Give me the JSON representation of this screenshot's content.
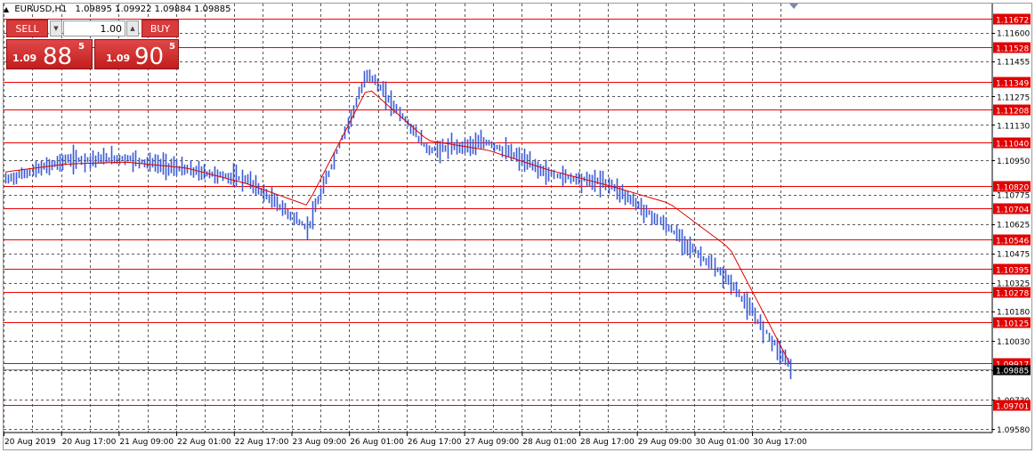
{
  "header": {
    "symbol": "EURUSD,H1",
    "ohlc": "1.09895 1.09922 1.09884 1.09885"
  },
  "trade_panel": {
    "sell_label": "SELL",
    "buy_label": "BUY",
    "volume": "1.00",
    "sell_price": {
      "small": "1.09",
      "big": "88",
      "sup": "5"
    },
    "buy_price": {
      "small": "1.09",
      "big": "90",
      "sup": "5"
    }
  },
  "colors": {
    "candle": "#3b5bd6",
    "moving_average": "#e00000",
    "level_line": "#ee0000",
    "label_bg": "#e00000",
    "grid": "#5a5a5a",
    "background": "#ffffff"
  },
  "price_axis": {
    "ticks": [
      "1.11600",
      "1.11455",
      "1.11275",
      "1.11130",
      "1.10950",
      "1.10775",
      "1.10625",
      "1.10475",
      "1.10325",
      "1.10180",
      "1.10030",
      "1.09880",
      "1.09730",
      "1.09580"
    ]
  },
  "levels": [
    {
      "label": "1.11672",
      "value": 1.11672
    },
    {
      "label": "1.11528",
      "value": 1.11528
    },
    {
      "label": "1.11349",
      "value": 1.11349
    },
    {
      "label": "1.11208",
      "value": 1.11208
    },
    {
      "label": "1.11040",
      "value": 1.1104
    },
    {
      "label": "1.10820",
      "value": 1.1082
    },
    {
      "label": "1.10704",
      "value": 1.10704
    },
    {
      "label": "1.10546",
      "value": 1.10546
    },
    {
      "label": "1.10395",
      "value": 1.10395
    },
    {
      "label": "1.10278",
      "value": 1.10278
    },
    {
      "label": "1.10125",
      "value": 1.10125
    },
    {
      "label": "1.09917",
      "value": 1.09917
    },
    {
      "label": "1.09701",
      "value": 1.09701
    }
  ],
  "current_price": {
    "label": "1.09885",
    "value": 1.09885
  },
  "time_axis": {
    "labels": [
      "20 Aug 2019",
      "20 Aug 17:00",
      "21 Aug 09:00",
      "22 Aug 01:00",
      "22 Aug 17:00",
      "23 Aug 09:00",
      "26 Aug 01:00",
      "26 Aug 17:00",
      "27 Aug 09:00",
      "28 Aug 01:00",
      "28 Aug 17:00",
      "29 Aug 09:00",
      "30 Aug 01:00",
      "30 Aug 17:00"
    ]
  },
  "chart_data": {
    "type": "line",
    "title": "EURUSD,H1",
    "xlabel": "",
    "ylabel": "",
    "ylim": [
      1.0958,
      1.1172
    ],
    "grid": true,
    "series": [
      {
        "name": "EURUSD,H1",
        "x": [
          "20 Aug 2019",
          "20 Aug 17:00",
          "21 Aug 09:00",
          "22 Aug 01:00",
          "22 Aug 17:00",
          "23 Aug 09:00",
          "26 Aug 01:00",
          "26 Aug 17:00",
          "27 Aug 09:00",
          "28 Aug 01:00",
          "28 Aug 17:00",
          "29 Aug 09:00",
          "30 Aug 01:00",
          "30 Aug 17:00"
        ],
        "values": [
          1.1085,
          1.1095,
          1.1096,
          1.109,
          1.1085,
          1.106,
          1.114,
          1.11,
          1.1104,
          1.1088,
          1.1083,
          1.106,
          1.1033,
          1.099
        ]
      },
      {
        "name": "",
        "x": [
          "20 Aug 2019",
          "20 Aug 17:00",
          "21 Aug 09:00",
          "22 Aug 01:00",
          "22 Aug 17:00",
          "23 Aug 09:00",
          "26 Aug 01:00",
          "26 Aug 17:00",
          "27 Aug 09:00",
          "28 Aug 01:00",
          "28 Aug 17:00",
          "29 Aug 09:00",
          "30 Aug 01:00",
          "30 Aug 17:00"
        ],
        "values": [
          1.1089,
          1.1093,
          1.1094,
          1.1091,
          1.1083,
          1.1072,
          1.1132,
          1.1105,
          1.11,
          1.109,
          1.1082,
          1.1073,
          1.105,
          1.0991
        ]
      }
    ]
  }
}
